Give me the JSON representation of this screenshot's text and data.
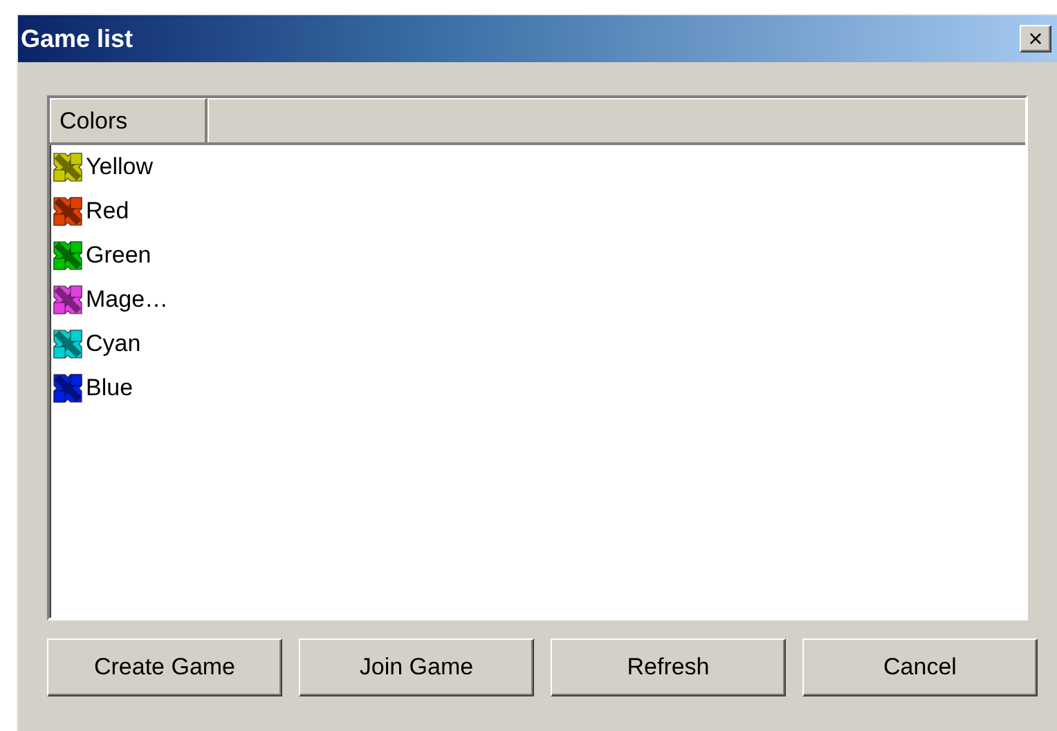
{
  "window": {
    "title": "Game list",
    "close": "×"
  },
  "list": {
    "columns": [
      "Colors"
    ],
    "items": [
      {
        "label": "Yellow",
        "color": "#c8c800"
      },
      {
        "label": "Red",
        "color": "#e04000"
      },
      {
        "label": "Green",
        "color": "#00c000"
      },
      {
        "label": "Mage…",
        "color": "#e040e0"
      },
      {
        "label": "Cyan",
        "color": "#00d0d0"
      },
      {
        "label": "Blue",
        "color": "#0020e0"
      }
    ]
  },
  "buttons": [
    "Create Game",
    "Join Game",
    "Refresh",
    "Cancel"
  ]
}
